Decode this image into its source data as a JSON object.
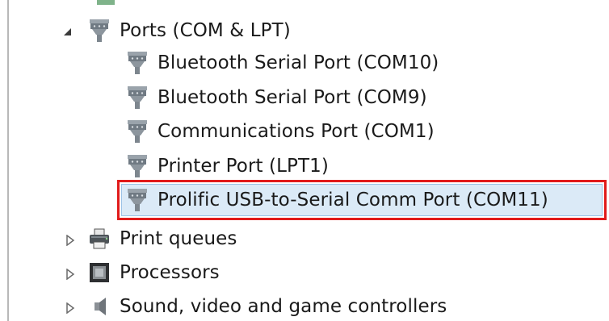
{
  "tree": {
    "ports": {
      "label": "Ports (COM & LPT)",
      "expanded": true,
      "icon": "serial-port-icon",
      "children": [
        {
          "label": "Bluetooth Serial Port (COM10)",
          "icon": "serial-port-icon"
        },
        {
          "label": "Bluetooth Serial Port (COM9)",
          "icon": "serial-port-icon"
        },
        {
          "label": "Communications Port (COM1)",
          "icon": "serial-port-icon"
        },
        {
          "label": "Printer Port (LPT1)",
          "icon": "serial-port-icon"
        },
        {
          "label": "Prolific USB-to-Serial Comm Port (COM11)",
          "icon": "serial-port-icon",
          "selected": true,
          "highlighted": true
        }
      ]
    },
    "print_queues": {
      "label": "Print queues",
      "expanded": false,
      "icon": "printer-icon"
    },
    "processors": {
      "label": "Processors",
      "expanded": false,
      "icon": "processor-icon"
    },
    "sound": {
      "label": "Sound, video and game controllers",
      "expanded": false,
      "icon": "speaker-icon"
    }
  },
  "colors": {
    "highlight_border": "#e11b1b",
    "selection_fill": "#dbeaf7",
    "selection_border": "#9cc3e6"
  }
}
